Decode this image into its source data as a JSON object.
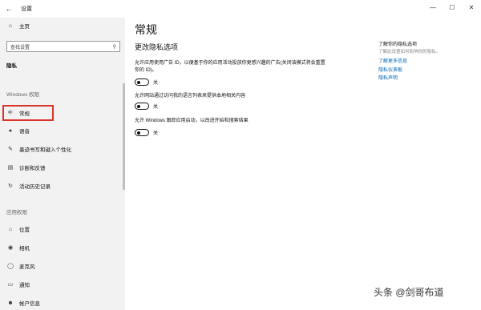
{
  "window": {
    "title": "设置",
    "back_icon": "back-arrow-icon",
    "minimize": "—",
    "maximize": "☐",
    "close": "✕"
  },
  "sidebar": {
    "home": {
      "label": "主页",
      "icon": "home-icon"
    },
    "search": {
      "placeholder": "查找设置"
    },
    "section": "隐私",
    "windows_permissions_label": "Windows 权限",
    "windows_items": [
      {
        "label": "常规",
        "icon": "lock-icon"
      },
      {
        "label": "语音",
        "icon": "voice-icon"
      },
      {
        "label": "墨迹书写和键入个性化",
        "icon": "ink-icon"
      },
      {
        "label": "诊断和反馈",
        "icon": "diagnostics-icon"
      },
      {
        "label": "活动历史记录",
        "icon": "history-icon"
      }
    ],
    "app_permissions_label": "应用权限",
    "app_items": [
      {
        "label": "位置",
        "icon": "location-icon"
      },
      {
        "label": "相机",
        "icon": "camera-icon"
      },
      {
        "label": "麦克风",
        "icon": "microphone-icon"
      },
      {
        "label": "通知",
        "icon": "notification-icon"
      },
      {
        "label": "帐户信息",
        "icon": "account-icon"
      }
    ]
  },
  "main": {
    "title": "常规",
    "subtitle": "更改隐私选项",
    "settings": [
      {
        "desc": "允许应用使用广告 ID，以便基于你的应用活动投放你更感兴趣的广告(关闭该模式将会重置你的 ID)。",
        "state": "关"
      },
      {
        "desc": "允许网站通过访问我的语言列表来提供本地相关内容",
        "state": "关"
      },
      {
        "desc": "允许 Windows 跟踪应用启动，以改进开始和搜索结果",
        "state": "关"
      }
    ]
  },
  "aside": {
    "title": "了解你的隐私选项",
    "desc": "了解此设置如何影响你的隐私。",
    "links": [
      "了解更多信息",
      "隐私仪表板",
      "隐私声明"
    ]
  },
  "watermark": "头条 @剑哥布道"
}
